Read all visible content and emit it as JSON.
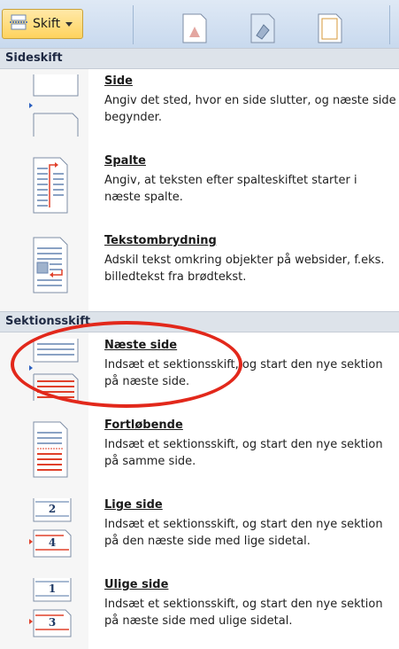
{
  "ribbon": {
    "skift_label": "Skift"
  },
  "sections": [
    {
      "header": "Sideskift"
    },
    {
      "header": "Sektionsskift"
    }
  ],
  "items": [
    {
      "title": "Side",
      "desc": "Angiv det sted, hvor en side slutter, og næste side begynder."
    },
    {
      "title": "Spalte",
      "desc": "Angiv, at teksten efter spalteskiftet starter i næste spalte."
    },
    {
      "title": "Tekstombrydning",
      "desc": "Adskil tekst omkring objekter på websider, f.eks. billedtekst fra brødtekst."
    },
    {
      "title": "Næste side",
      "desc": "Indsæt et sektionsskift, og start den nye sektion på næste side."
    },
    {
      "title": "Fortløbende",
      "desc": "Indsæt et sektionsskift, og start den nye sektion på samme side."
    },
    {
      "title": "Lige side",
      "desc": "Indsæt et sektionsskift, og start den nye sektion på den næste side med lige sidetal."
    },
    {
      "title": "Ulige side",
      "desc": "Indsæt et sektionsskift, og start den nye sektion på næste side med ulige sidetal."
    }
  ],
  "icon_numbers": {
    "even_top": "2",
    "even_bottom": "4",
    "odd_top": "1",
    "odd_bottom": "3"
  },
  "colors": {
    "highlight_circle": "#e2281b",
    "page_break_marker": "#e0402a",
    "link_arrow": "#2b5fbf"
  }
}
